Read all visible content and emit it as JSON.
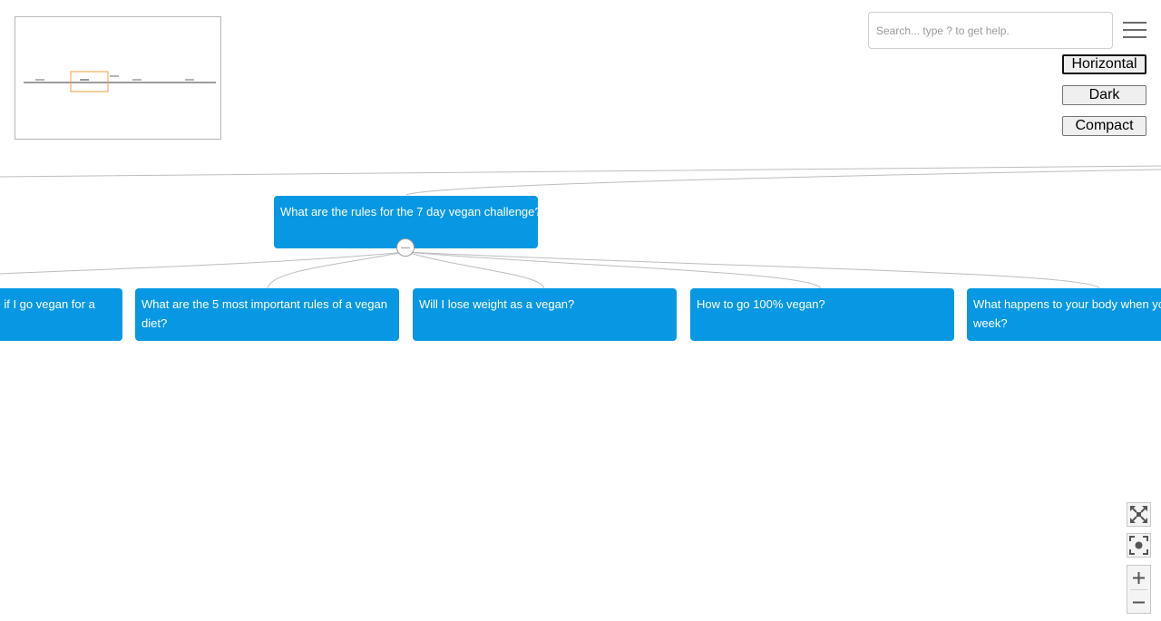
{
  "minimap": {
    "label": "minimap"
  },
  "search": {
    "placeholder": "Search... type ? to get help."
  },
  "menu": {
    "icon": "hamburger-menu-icon"
  },
  "options": {
    "horizontal_label": "Horizontal",
    "dark_label": "Dark",
    "compact_label": "Compact",
    "active": "Horizontal"
  },
  "colors": {
    "node_fill": "#0898e3",
    "node_text": "#ffffff",
    "link": "#bdbdbd",
    "minimap_viewport": "#f0a040"
  },
  "tree": {
    "root": {
      "label": "What are the rules for the 7 day vegan challenge?"
    },
    "children": [
      {
        "label": "What happens to your body if I go vegan for a week?",
        "visible_label": "se if I go vegan for a"
      },
      {
        "label": "What are the 5 most important rules of a vegan diet?"
      },
      {
        "label": "Will I lose weight as a vegan?"
      },
      {
        "label": "How to go 100% vegan?"
      },
      {
        "label": "What happens to your body when you go vegan for a week?",
        "visible_label": "What happens to your body when yo for a week?"
      }
    ]
  },
  "controls": {
    "fit_icon": "fit-screen-icon",
    "center_icon": "center-focus-icon",
    "zoom_in_icon": "zoom-in-icon",
    "zoom_out_icon": "zoom-out-icon"
  }
}
